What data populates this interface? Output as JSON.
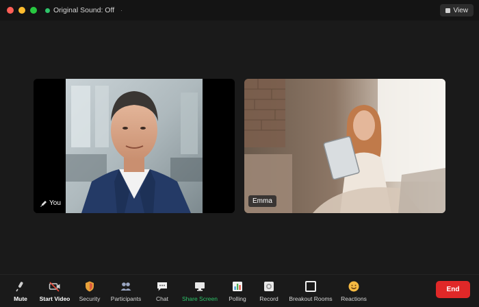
{
  "titlebar": {
    "sound_status": "Original Sound: Off",
    "sound_extra": "·",
    "view_label": "View",
    "colors": {
      "close": "#ff5f57",
      "minimize": "#febc2e",
      "maximize": "#28c840",
      "sound_dot": "#2ec46a"
    }
  },
  "participants": [
    {
      "name": "You",
      "icon": "mic-icon"
    },
    {
      "name": "Emma"
    }
  ],
  "toolbar": {
    "items": [
      {
        "label": "Mute",
        "icon": "microphone-icon"
      },
      {
        "label": "Start Video",
        "icon": "video-camera-off-icon"
      },
      {
        "label": "Security",
        "icon": "shield-icon"
      },
      {
        "label": "Participants",
        "icon": "participants-icon"
      },
      {
        "label": "Chat",
        "icon": "chat-bubble-icon"
      },
      {
        "label": "Share Screen",
        "icon": "share-screen-icon",
        "color": "#2ec46a"
      },
      {
        "label": "Polling",
        "icon": "bar-chart-icon"
      },
      {
        "label": "Record",
        "icon": "record-icon"
      },
      {
        "label": "Breakout Rooms",
        "icon": "breakout-rooms-icon"
      },
      {
        "label": "Reactions",
        "icon": "smiley-icon"
      }
    ],
    "end_label": "End",
    "end_color": "#e02828"
  }
}
